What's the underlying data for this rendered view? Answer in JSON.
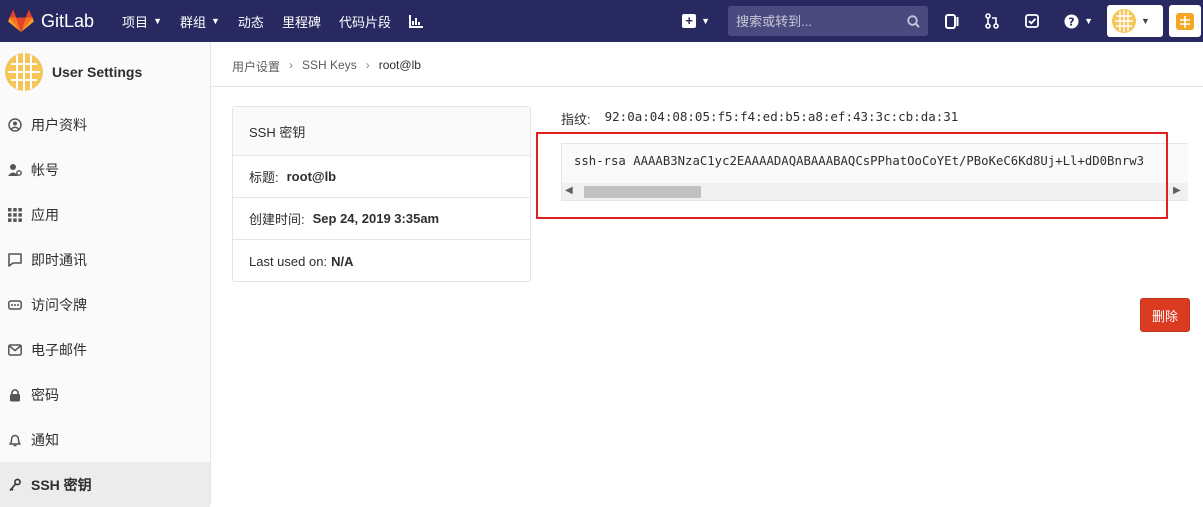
{
  "navbar": {
    "brand": "GitLab",
    "items": [
      {
        "label": "项目",
        "dropdown": true
      },
      {
        "label": "群组",
        "dropdown": true
      },
      {
        "label": "动态",
        "dropdown": false
      },
      {
        "label": "里程碑",
        "dropdown": false
      },
      {
        "label": "代码片段",
        "dropdown": false
      }
    ],
    "search_placeholder": "搜索或转到...",
    "colors": {
      "bg": "#292961",
      "logo": "#fc6d26"
    }
  },
  "sidebar": {
    "title": "User Settings",
    "items": [
      {
        "label": "用户资料",
        "icon": "profile-icon"
      },
      {
        "label": "帐号",
        "icon": "account-icon"
      },
      {
        "label": "应用",
        "icon": "applications-icon"
      },
      {
        "label": "即时通讯",
        "icon": "chat-icon"
      },
      {
        "label": "访问令牌",
        "icon": "token-icon"
      },
      {
        "label": "电子邮件",
        "icon": "email-icon"
      },
      {
        "label": "密码",
        "icon": "lock-icon"
      },
      {
        "label": "通知",
        "icon": "bell-icon"
      },
      {
        "label": "SSH 密钥",
        "icon": "key-icon",
        "active": true
      }
    ]
  },
  "breadcrumb": [
    "用户设置",
    "SSH Keys",
    "root@lb"
  ],
  "key_card": {
    "header": "SSH 密钥",
    "title_label": "标题:",
    "title_value": "root@lb",
    "created_label": "创建时间:",
    "created_value": "Sep 24, 2019 3:35am",
    "last_used_label": "Last used on:",
    "last_used_value": "N/A"
  },
  "fingerprint": {
    "label": "指纹:",
    "value": "92:0a:04:08:05:f5:f4:ed:b5:a8:ef:43:3c:cb:da:31"
  },
  "key_text": "ssh-rsa AAAAB3NzaC1yc2EAAAADAQABAAABAQCsPPhatOoCoYEt/PBoKeC6Kd8Uj+Ll+dD0Bnrw3",
  "delete_label": "删除",
  "colors": {
    "delete": "#db3b21",
    "highlight": "#e02020"
  }
}
